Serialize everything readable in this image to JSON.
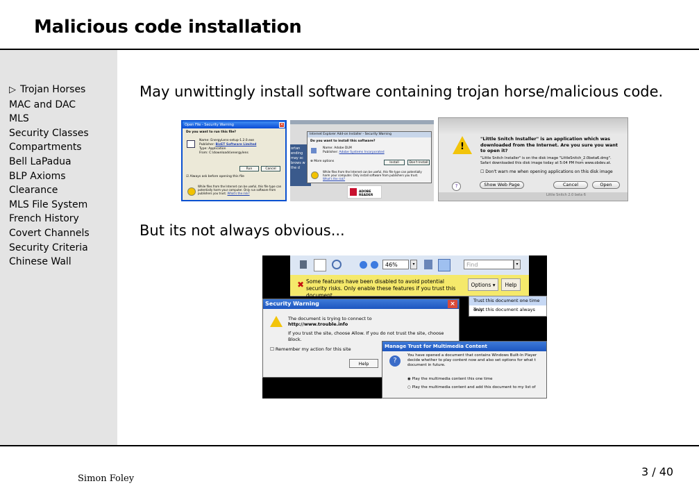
{
  "title": "Malicious code installation",
  "nav": [
    {
      "label": "Trojan Horses",
      "active": true,
      "marker": "▷"
    },
    {
      "label": "MAC and DAC"
    },
    {
      "label": "MLS"
    },
    {
      "label": "Security Classes"
    },
    {
      "label": "Compartments"
    },
    {
      "label": "Bell LaPadua"
    },
    {
      "label": "BLP Axioms"
    },
    {
      "label": "Clearance"
    },
    {
      "label": "MLS File System"
    },
    {
      "label": "French History"
    },
    {
      "label": "Covert Channels"
    },
    {
      "label": "Security Criteria"
    },
    {
      "label": "Chinese Wall"
    }
  ],
  "body": {
    "line1": "May unwittingly install software containing trojan horse/malicious code.",
    "line2": "But its not always obvious..."
  },
  "shot1": {
    "title": "Open File - Security Warning",
    "question": "Do you want to run this file?",
    "name_label": "Name:",
    "name_value": "EnergyLens-setup-1.2.0.exe",
    "publisher_label": "Publisher:",
    "publisher_value": "BizET Software Limited",
    "type_label": "Type:",
    "type_value": "Application",
    "from_label": "From:",
    "from_value": "C:\\downloads\\energylens",
    "run": "Run",
    "cancel": "Cancel",
    "checkbox": "Always ask before opening this file",
    "warning": "While files from the Internet can be useful, this file type can potentially harm your computer. Only run software from publishers you trust.",
    "link": "What's the risk?"
  },
  "shot2": {
    "title": "Internet Explorer Add-on Installer - Security Warning",
    "question": "Do you want to install this software?",
    "name_label": "Name:",
    "name_value": "Adobe DLM",
    "publisher_label": "Publisher:",
    "publisher_value": "Adobe Systems Incorporated",
    "more": "More options",
    "install": "Install",
    "dont": "Don't Install",
    "warning": "While files from the Internet can be useful, this file type can potentially harm your computer. Only install software from publishers you trust.",
    "link": "What's the risk?",
    "side_text": "ortan ending may sc brows w the d",
    "adobe": "ADOBE READER"
  },
  "shot3": {
    "heading": "\"Little Snitch Installer\" is an application which was downloaded from the Internet. Are you sure you want to open it?",
    "detail": "\"Little Snitch Installer\" is on the disk image \"LittleSnitch_2.0beta6.dmg\". Safari downloaded this disk image today at 5:04 PM from www.obdev.at.",
    "checkbox": "Don't warn me when opening applications on this disk image",
    "show": "Show Web Page",
    "cancel": "Cancel",
    "open": "Open",
    "help": "?",
    "bottom": "Little Snitch 2.0 beta 6"
  },
  "shot4": {
    "zoom": "46%",
    "find": "Find",
    "bar_text": "Some features have been disabled to avoid potential security risks. Only enable these features if you trust this document.",
    "options": "Options",
    "help_btn": "Help",
    "menu": [
      "Trust this document one time only",
      "Trust this document always"
    ],
    "sw_title": "Security Warning",
    "sw_line1": "The document is trying to connect to",
    "sw_url": "http://www.trouble.info",
    "sw_line2": "If you trust the site, choose Allow. If you do not trust the site, choose Block.",
    "sw_remember": "Remember my action for this site",
    "sw_help": "Help",
    "mt_title": "Manage Trust for Multimedia Content",
    "mt_text": "You have opened a document that contains Windows Built-In Player decide whether to play content now and also set options for what t document in future.",
    "mt_opt1": "Play the multimedia content this one time",
    "mt_opt2": "Play the multimedia content and add this document to my list of"
  },
  "footer": {
    "author": "Simon Foley",
    "page": "3 / 40"
  }
}
